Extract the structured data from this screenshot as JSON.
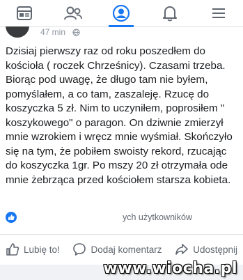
{
  "nav": {
    "tabs": [
      {
        "icon": "feed-icon",
        "active": false
      },
      {
        "icon": "friends-icon",
        "active": false
      },
      {
        "icon": "profile-icon",
        "active": true
      },
      {
        "icon": "notifications-bell-icon",
        "active": false
      },
      {
        "icon": "menu-icon",
        "active": false
      }
    ],
    "accent_color": "#1877f2"
  },
  "post": {
    "timestamp": "47 min",
    "text": "Dzisiaj pierwszy raz od roku poszedłem do kościoła ( roczek Chrześnicy). Czasami trzeba. Biorąc pod uwagę, że długo tam nie byłem, pomyślałem, a co tam, zaszaleję. Rzucę do koszyczka 5 zł. Nim to uczyniłem, poprosiłem \" koszykowego\" o paragon. On dziwnie zmierzył mnie wzrokiem i wręcz mnie wyśmiał. Skończyło się na tym, że pobiłem swoisty rekord, rzucając do koszyczka 1gr. Po mszy 20 zł otrzymała ode mnie żebrząca przed kościołem starsza kobieta.",
    "reactions_text": "ych użytkowników"
  },
  "actions": {
    "like_label": "Lubię to!",
    "comment_label": "Dodaj komentarz",
    "share_label": "Udostępnij"
  },
  "watermark": "www.wiocha.pl"
}
